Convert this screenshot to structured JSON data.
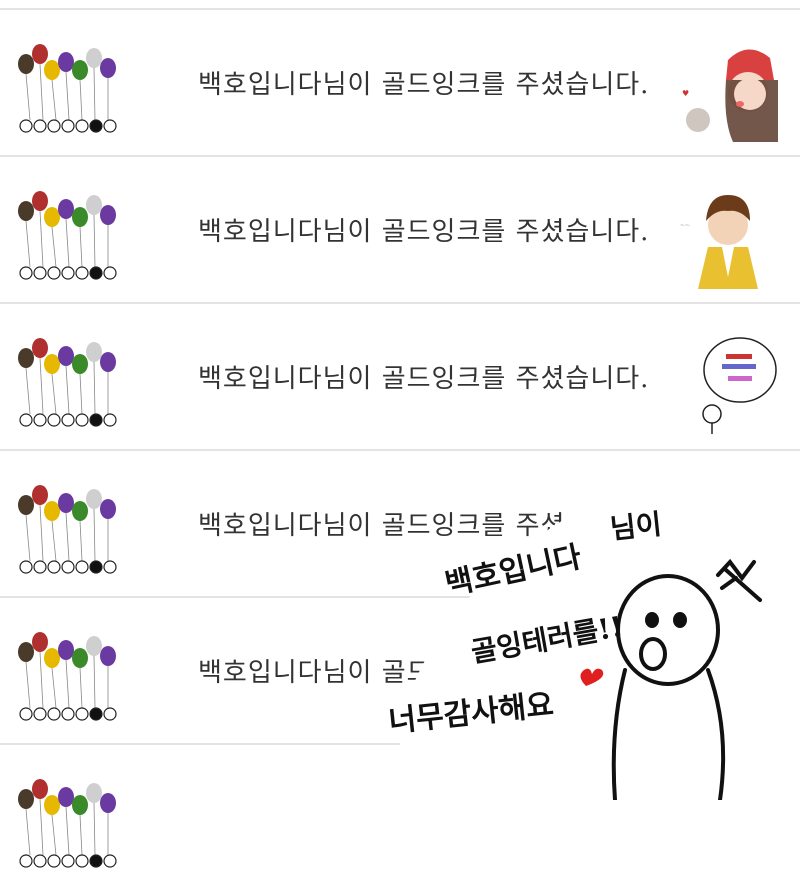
{
  "feed": {
    "items": [
      {
        "message": "백호입니다님이 골드잉크를 주셨습니다.",
        "sticker": "girl-red-beanie-sticker"
      },
      {
        "message": "백호입니다님이 골드잉크를 주셨습니다.",
        "sticker": "boy-yellow-vest-sticker"
      },
      {
        "message": "백호입니다님이 골드잉크를 주셨습니다.",
        "sticker": "stick-figure-thanks-sticker"
      },
      {
        "message": "백호입니다님이 골드잉크를 주셨습니다.",
        "sticker": "red-card-sticker"
      },
      {
        "message": "백호입니다님이 골드잉크를 주셨습니다.",
        "sticker": ""
      },
      {
        "message": "",
        "sticker": ""
      }
    ]
  },
  "overlay_note": {
    "line1": "백호입니다",
    "line2": "님이",
    "line3": "골잉테러를!!",
    "line4": "너무감사해요"
  },
  "colors": {
    "separator": "#e3e3e3",
    "text": "#333333",
    "heart": "#e02020",
    "balloon_green": "#3a8a2a",
    "balloon_purple": "#6a3aa0",
    "balloon_yellow": "#e6b800",
    "balloon_red": "#b03030"
  }
}
